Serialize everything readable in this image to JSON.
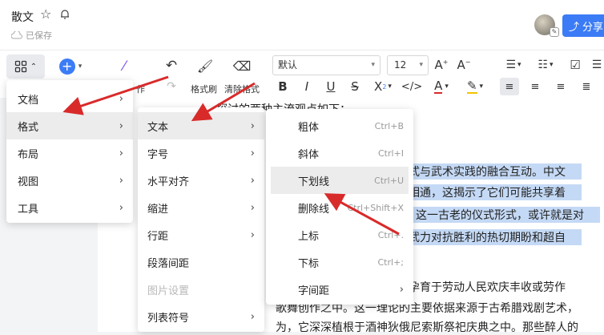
{
  "header": {
    "title": "散文",
    "save_status": "已保存",
    "share_label": "分享"
  },
  "toolbar": {
    "labels": {
      "format_painter": "格式刷",
      "clear_format": "清除格式",
      "partial_label": "作"
    },
    "font_name": "默认",
    "font_size": "12"
  },
  "document": {
    "lines": [
      "探讨的两种主流观点如下：",
      "教仪式与武术实践的融合互动。中文",
      "语义相通，这揭示了它们可能共享着",
      "。这一古老的仪式形式，或许就是对",
      "讨于武力对抗胜利的热切期盼和超自",
      "戏剧孕育于劳动人民欢庆丰收或劳作",
      "歌舞创作之中。这一理论的主要依据来源于古希腊戏剧艺术，",
      "为，它深深植根于酒神狄俄尼索斯祭祀庆典之中。那些醉人的"
    ]
  },
  "menus": {
    "level1": [
      {
        "label": "文档",
        "submenu": true
      },
      {
        "label": "格式",
        "submenu": true,
        "active": true
      },
      {
        "label": "布局",
        "submenu": true
      },
      {
        "label": "视图",
        "submenu": true
      },
      {
        "label": "工具",
        "submenu": true
      }
    ],
    "level2": [
      {
        "label": "文本",
        "submenu": true,
        "active": true
      },
      {
        "label": "字号",
        "submenu": true
      },
      {
        "label": "水平对齐",
        "submenu": true
      },
      {
        "label": "缩进",
        "submenu": true
      },
      {
        "label": "行距",
        "submenu": true
      },
      {
        "label": "段落间距",
        "submenu": false
      },
      {
        "label": "图片设置",
        "submenu": false,
        "disabled": true
      },
      {
        "label": "列表符号",
        "submenu": true
      }
    ],
    "level3": [
      {
        "label": "粗体",
        "shortcut": "Ctrl+B"
      },
      {
        "label": "斜体",
        "shortcut": "Ctrl+I"
      },
      {
        "label": "下划线",
        "shortcut": "Ctrl+U",
        "active": true
      },
      {
        "label": "删除线",
        "shortcut": "Ctrl+Shift+X"
      },
      {
        "label": "上标",
        "shortcut": "Ctrl+."
      },
      {
        "label": "下标",
        "shortcut": "Ctrl+;"
      },
      {
        "label": "字间距",
        "submenu": true
      }
    ]
  },
  "colors": {
    "accent": "#3b7cf6",
    "highlight": "#c4d9f5",
    "annotation_arrow": "#d92a2a"
  }
}
